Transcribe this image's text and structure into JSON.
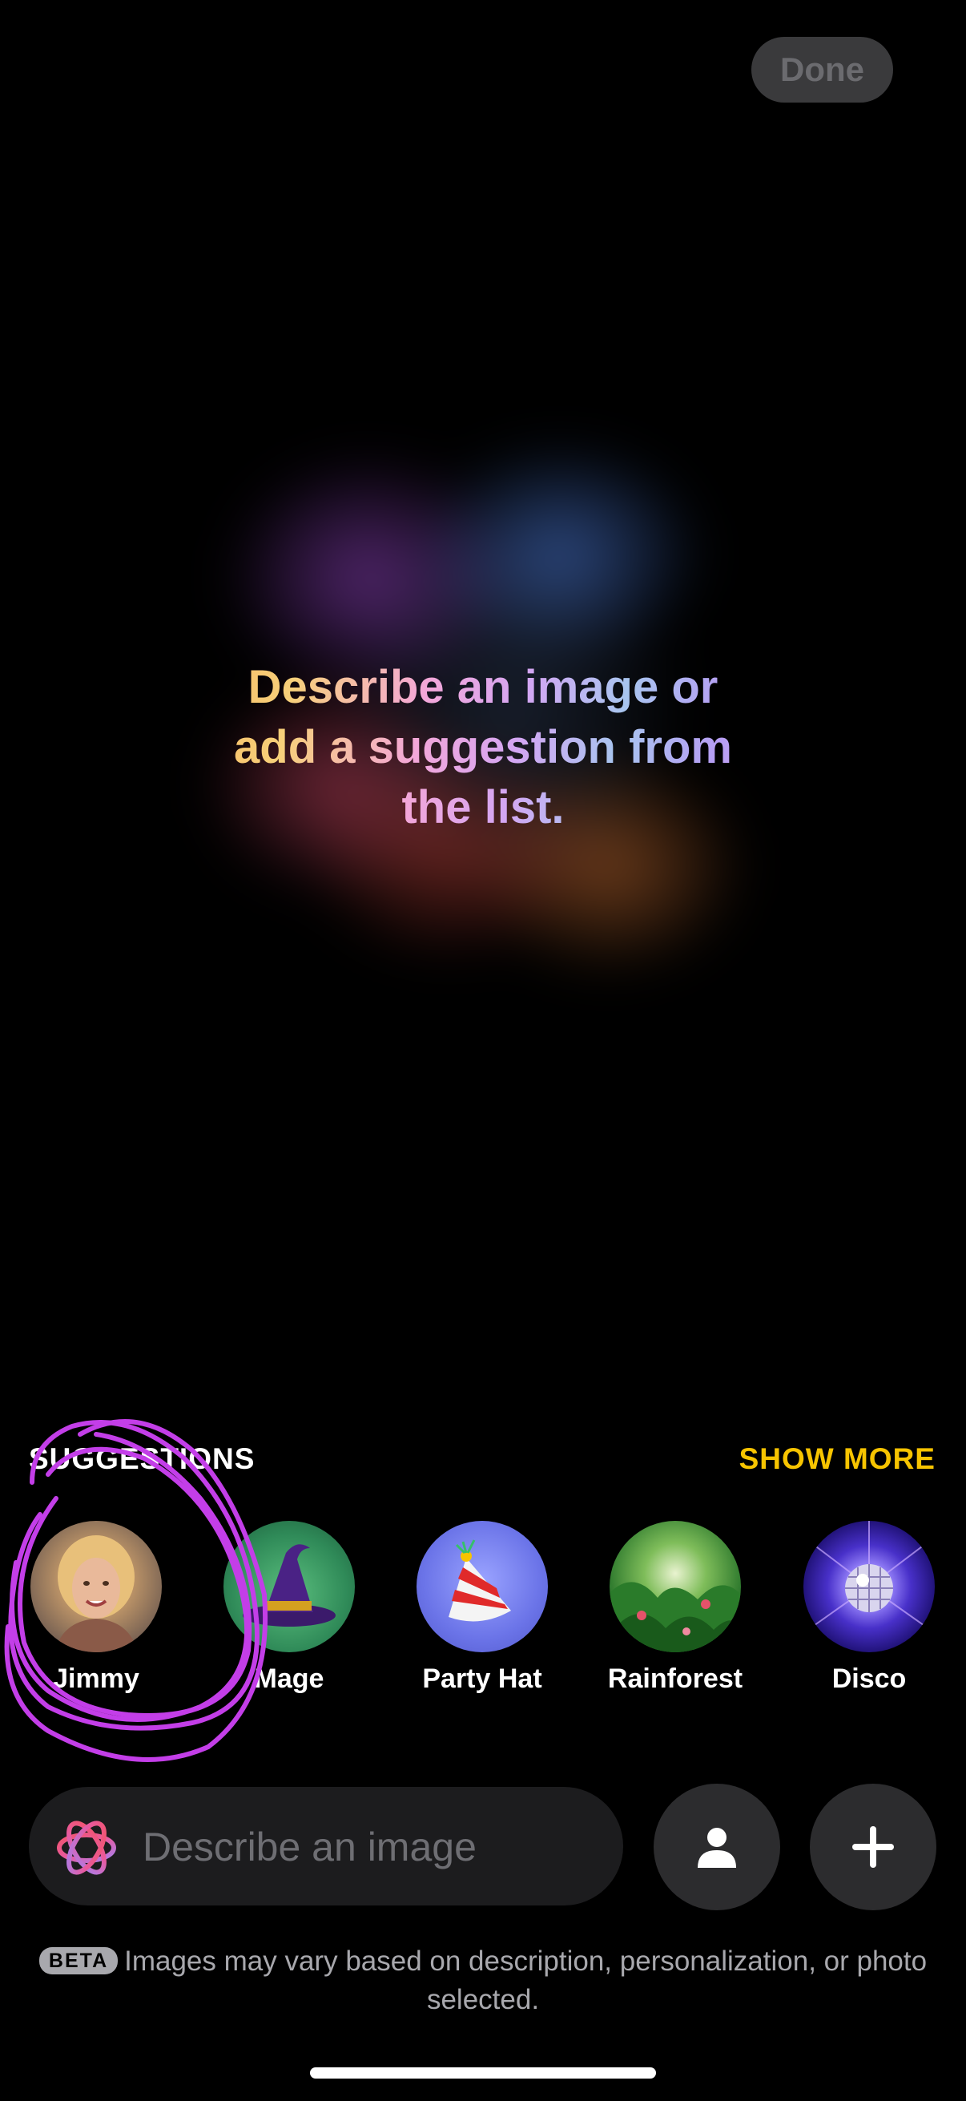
{
  "header": {
    "done_label": "Done"
  },
  "canvas": {
    "prompt_line1": "Describe an image or",
    "prompt_line2": "add a suggestion from",
    "prompt_line3": "the list."
  },
  "suggestions": {
    "title": "SUGGESTIONS",
    "show_more_label": "SHOW MORE",
    "items": [
      {
        "label": "Jimmy"
      },
      {
        "label": "Mage"
      },
      {
        "label": "Party Hat"
      },
      {
        "label": "Rainforest"
      },
      {
        "label": "Disco"
      }
    ]
  },
  "composer": {
    "placeholder": "Describe an image",
    "person_button_icon": "person-icon",
    "add_button_icon": "plus-icon"
  },
  "footer": {
    "beta_badge": "BETA",
    "note": "Images may vary based on description, personalization, or photo selected."
  },
  "colors": {
    "background": "#000000",
    "accent_show_more": "#f7c400",
    "annotation_scribble": "#c33ee8"
  }
}
